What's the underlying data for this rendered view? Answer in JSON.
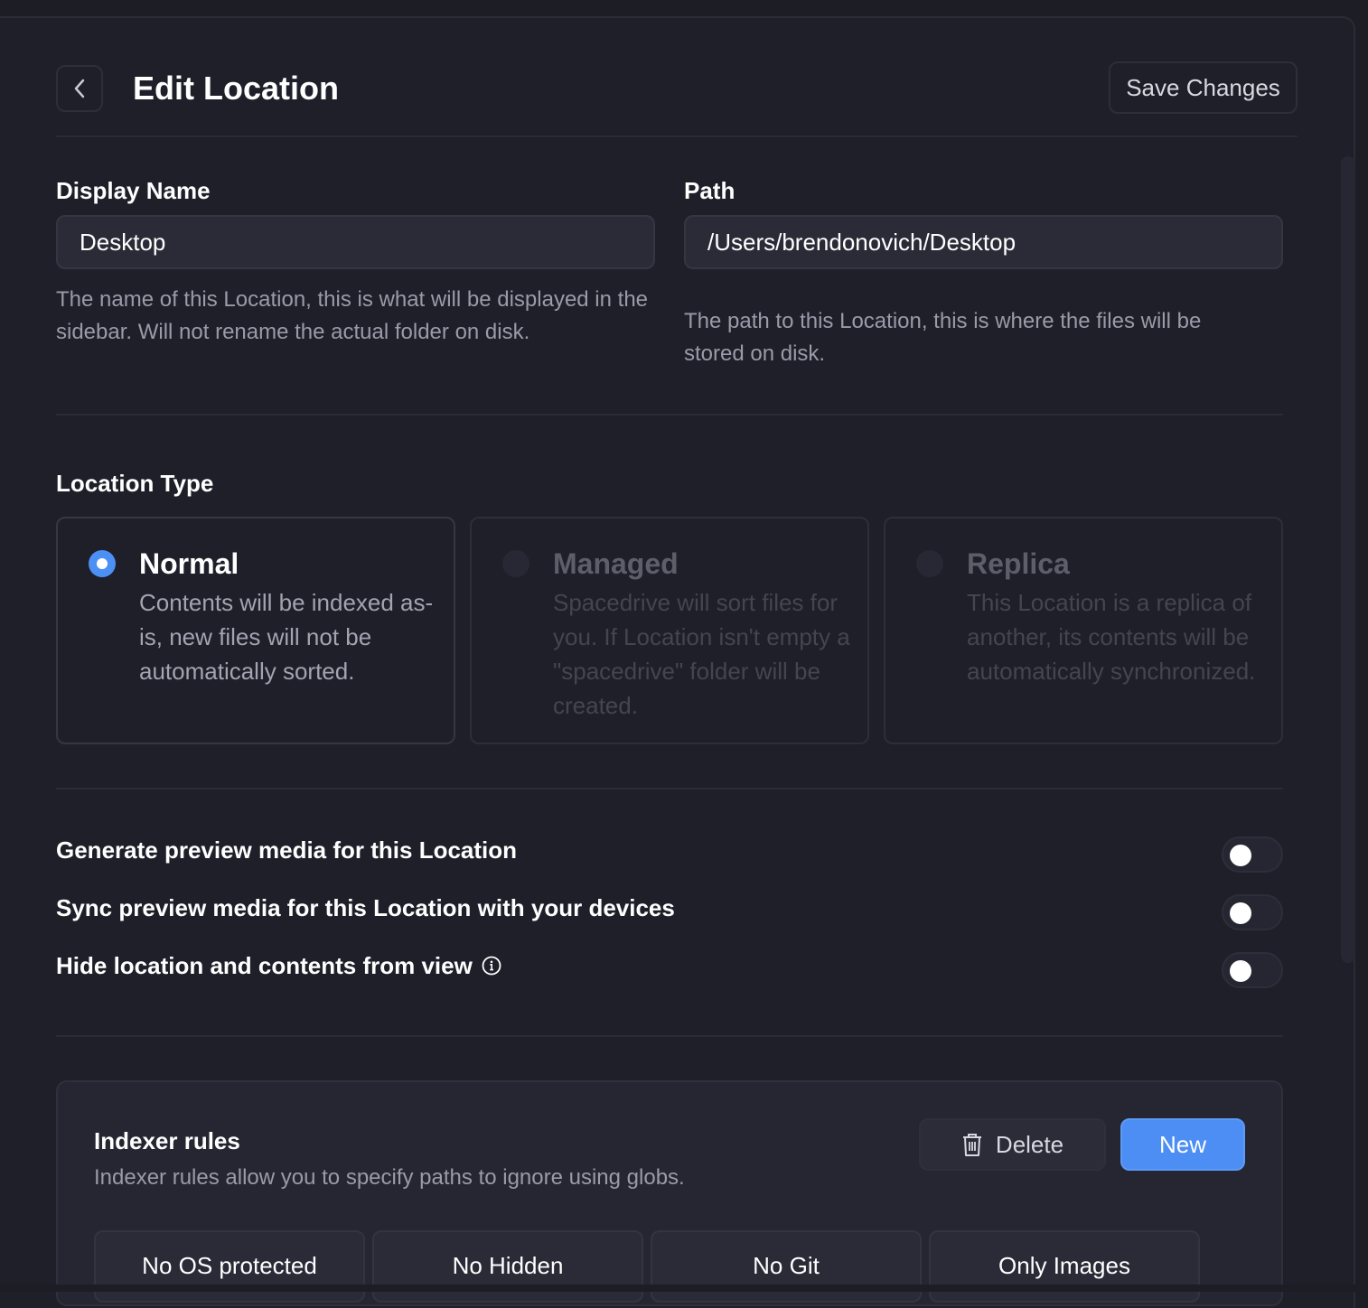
{
  "header": {
    "title": "Edit Location",
    "save_label": "Save Changes",
    "back_icon": "chevron-left-icon"
  },
  "display_name": {
    "label": "Display Name",
    "value": "Desktop",
    "help": "The name of this Location, this is what will be displayed in the sidebar. Will not rename the actual folder on disk."
  },
  "path": {
    "label": "Path",
    "value": "/Users/brendonovich/Desktop",
    "help": "The path to this Location, this is where the files will be stored on disk."
  },
  "location_type": {
    "title": "Location Type",
    "selected": "Normal",
    "options": [
      {
        "title": "Normal",
        "description": "Contents will be indexed as-is, new files will not be automatically sorted.",
        "enabled": true
      },
      {
        "title": "Managed",
        "description": "Spacedrive will sort files for you. If Location isn't empty a \"spacedrive\" folder will be created.",
        "enabled": false
      },
      {
        "title": "Replica",
        "description": "This Location is a replica of another, its contents will be automatically synchronized.",
        "enabled": false
      }
    ]
  },
  "toggles": [
    {
      "label": "Generate preview media for this Location",
      "on": false
    },
    {
      "label": "Sync preview media for this Location with your devices",
      "on": false
    },
    {
      "label": "Hide location and contents from view",
      "on": false,
      "icon": "info-icon"
    }
  ],
  "indexer_rules": {
    "title": "Indexer rules",
    "description": "Indexer rules allow you to specify paths to ignore using globs.",
    "delete_label": "Delete",
    "delete_icon": "trash-icon",
    "new_label": "New",
    "rules": [
      "No OS protected",
      "No Hidden",
      "No Git",
      "Only Images"
    ]
  },
  "colors": {
    "background": "#1e1f29",
    "accent": "#4c8ef3",
    "input_bg": "#2a2b37",
    "muted_text": "#9a9ba8"
  }
}
